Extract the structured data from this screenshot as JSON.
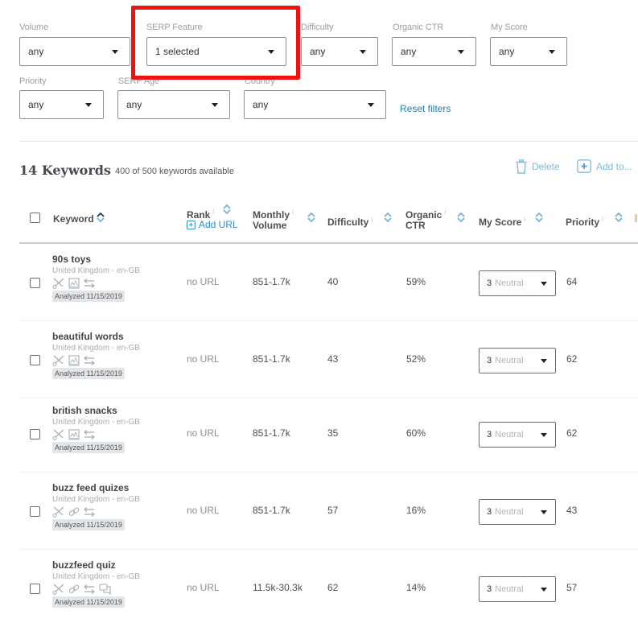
{
  "filters": {
    "row1": [
      {
        "id": "volume",
        "label": "Volume",
        "value": "any"
      },
      {
        "id": "serp-feature",
        "label": "SERP Feature",
        "value": "1 selected"
      },
      {
        "id": "difficulty",
        "label": "Difficulty",
        "value": "any"
      },
      {
        "id": "organic-ctr",
        "label": "Organic CTR",
        "value": "any"
      },
      {
        "id": "my-score",
        "label": "My Score",
        "value": "any"
      }
    ],
    "row2": [
      {
        "id": "priority",
        "label": "Priority",
        "value": "any"
      },
      {
        "id": "serp-age",
        "label": "SERP Age",
        "value": "any"
      },
      {
        "id": "country",
        "label": "Country",
        "value": "any"
      }
    ],
    "reset_label": "Reset filters"
  },
  "keywords": {
    "title": "14 Keywords",
    "subtitle": "400 of 500 keywords available",
    "delete_label": "Delete",
    "add_to_label": "Add to..."
  },
  "table": {
    "headers": {
      "keyword": "Keyword",
      "rank": "Rank",
      "add_url": "Add URL",
      "monthly_1": "Monthly",
      "monthly_2": "Volume",
      "difficulty": "Difficulty",
      "ctr_1": "Organic",
      "ctr_2": "CTR",
      "my_score": "My Score",
      "priority": "Priority",
      "info_glyph": "i"
    },
    "rows": [
      {
        "keyword": "90s toys",
        "location": "United Kingdom - en-GB",
        "features": [
          "scissors-icon",
          "image-icon",
          "transfer-icon"
        ],
        "analyzed": "Analyzed 11/15/2019",
        "rank": "no URL",
        "volume": "851-1.7k",
        "difficulty": "40",
        "ctr": "59%",
        "score_num": "3",
        "score_label": "Neutral",
        "priority": "64"
      },
      {
        "keyword": "beautiful words",
        "location": "United Kingdom - en-GB",
        "features": [
          "scissors-icon",
          "image-icon",
          "transfer-icon"
        ],
        "analyzed": "Analyzed 11/15/2019",
        "rank": "no URL",
        "volume": "851-1.7k",
        "difficulty": "43",
        "ctr": "52%",
        "score_num": "3",
        "score_label": "Neutral",
        "priority": "62"
      },
      {
        "keyword": "british snacks",
        "location": "United Kingdom - en-GB",
        "features": [
          "scissors-icon",
          "image-icon",
          "transfer-icon"
        ],
        "analyzed": "Analyzed 11/15/2019",
        "rank": "no URL",
        "volume": "851-1.7k",
        "difficulty": "35",
        "ctr": "60%",
        "score_num": "3",
        "score_label": "Neutral",
        "priority": "62"
      },
      {
        "keyword": "buzz feed quizes",
        "location": "United Kingdom - en-GB",
        "features": [
          "scissors-icon",
          "link-icon",
          "transfer-icon"
        ],
        "analyzed": "Analyzed 11/15/2019",
        "rank": "no URL",
        "volume": "851-1.7k",
        "difficulty": "57",
        "ctr": "16%",
        "score_num": "3",
        "score_label": "Neutral",
        "priority": "43"
      },
      {
        "keyword": "buzzfeed quiz",
        "location": "United Kingdom - en-GB",
        "features": [
          "scissors-icon",
          "link-icon",
          "transfer-icon",
          "chat-icon"
        ],
        "analyzed": "Analyzed 11/15/2019",
        "rank": "no URL",
        "volume": "11.5k-30.3k",
        "difficulty": "62",
        "ctr": "14%",
        "score_num": "3",
        "score_label": "Neutral",
        "priority": "57"
      }
    ]
  },
  "colors": {
    "highlight": "#f21111",
    "link": "#1a7fb5",
    "action": "#7fbad9",
    "sort_icon": "#7fbad9"
  }
}
